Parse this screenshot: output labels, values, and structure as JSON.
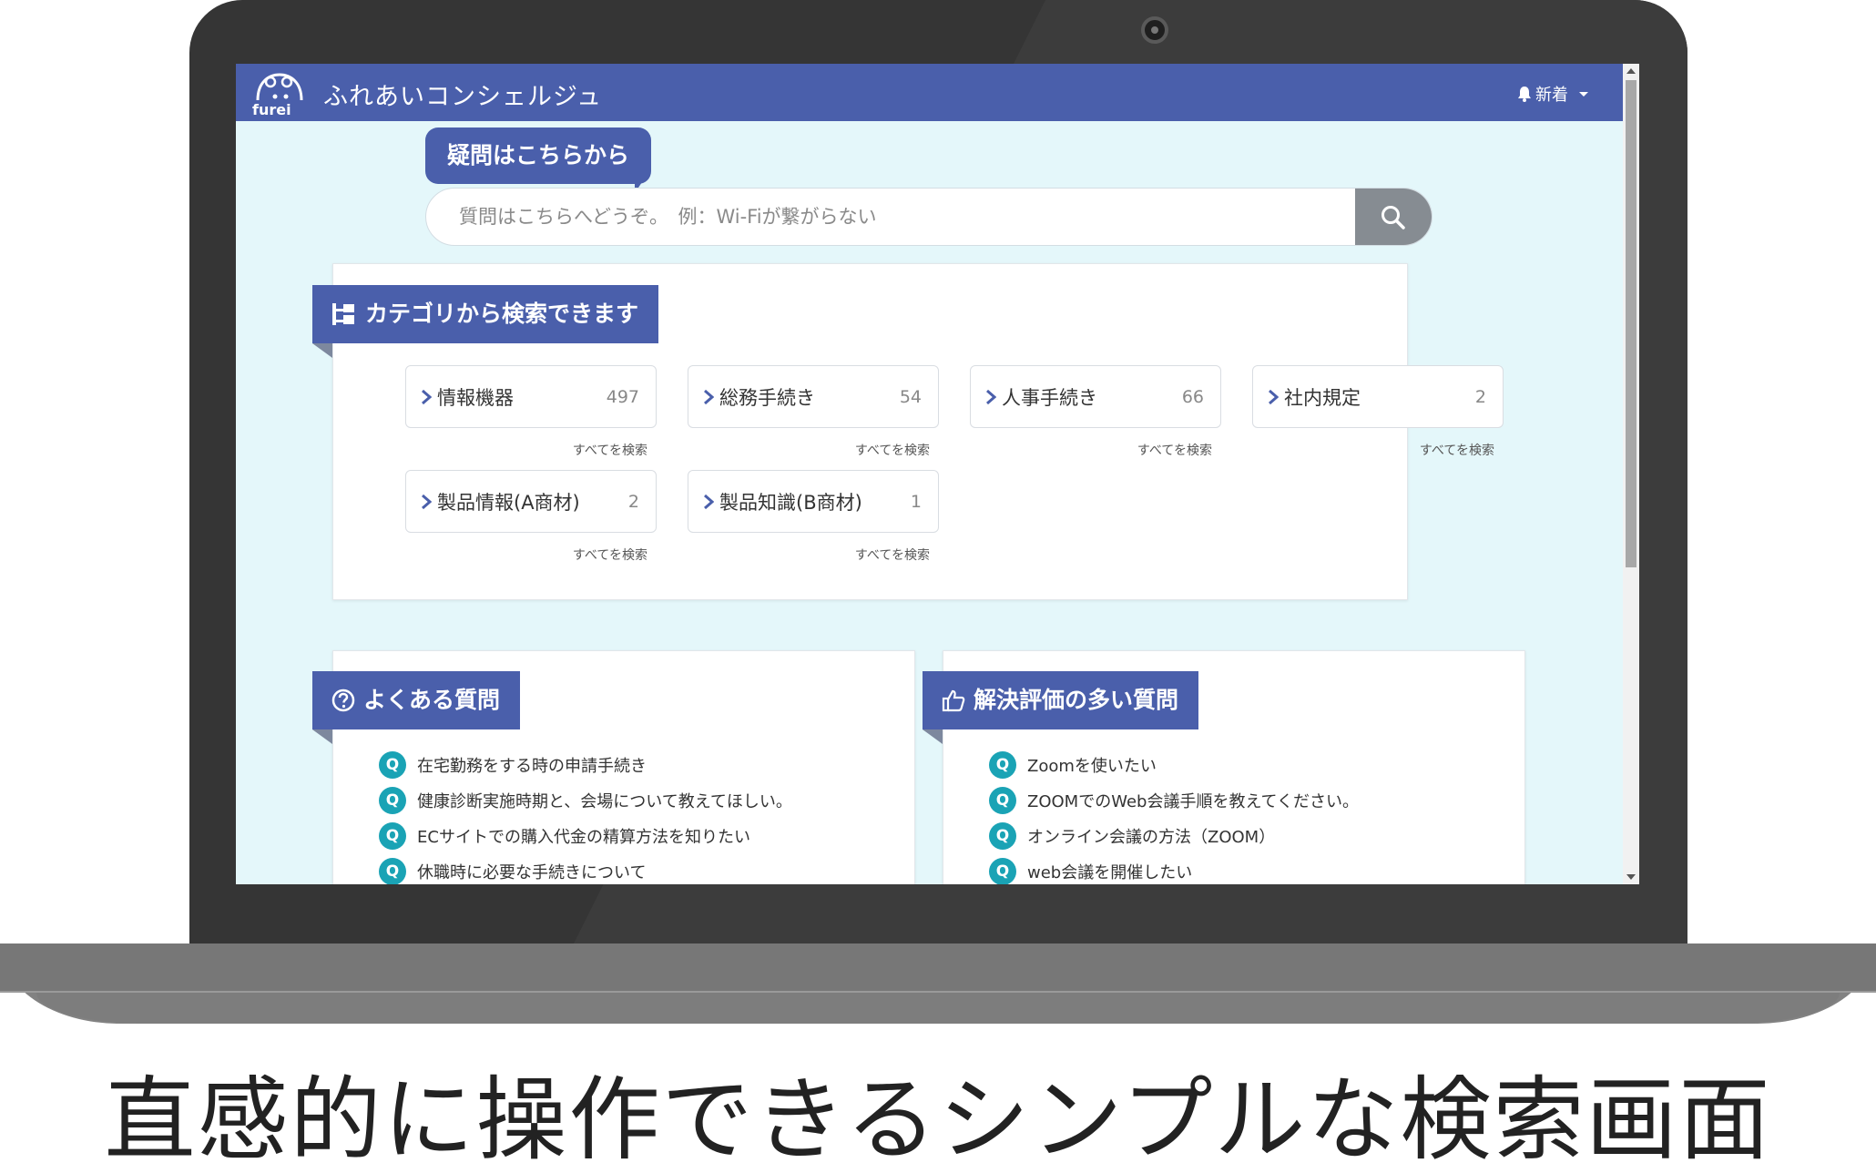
{
  "app": {
    "title": "ふれあいコンシェルジュ",
    "logo_text": "furei",
    "news_label": "新着"
  },
  "search": {
    "bubble_label": "疑問はこちらから",
    "placeholder": "質問はこちらへどうぞ。　例：Wi-Fiが繋がらない"
  },
  "categories": {
    "heading": "カテゴリから検索できます",
    "items": [
      {
        "label": "情報機器",
        "count": "497",
        "all_label": "すべてを検索"
      },
      {
        "label": "総務手続き",
        "count": "54",
        "all_label": "すべてを検索"
      },
      {
        "label": "人事手続き",
        "count": "66",
        "all_label": "すべてを検索"
      },
      {
        "label": "社内規定",
        "count": "2",
        "all_label": "すべてを検索"
      },
      {
        "label": "製品情報(A商材)",
        "count": "2",
        "all_label": "すべてを検索"
      },
      {
        "label": "製品知識(B商材)",
        "count": "1",
        "all_label": "すべてを検索"
      }
    ]
  },
  "faq": {
    "heading": "よくある質問",
    "badge": "Q",
    "items": [
      "在宅勤務をする時の申請手続き",
      "健康診断実施時期と、会場について教えてほしい。",
      "ECサイトでの購入代金の精算方法を知りたい",
      "休職時に必要な手続きについて"
    ]
  },
  "top_rated": {
    "heading": "解決評価の多い質問",
    "badge": "Q",
    "items": [
      "Zoomを使いたい",
      "ZOOMでのWeb会議手順を教えてください。",
      "オンライン会議の方法（ZOOM）",
      "web会議を開催したい"
    ]
  },
  "caption": "直感的に操作できるシンプルな検索画面",
  "colors": {
    "brand": "#4a5fab",
    "screen_bg": "#e4f7fa",
    "q_badge": "#1aa3b5",
    "laptop_body": "#353535",
    "laptop_base": "#828282"
  }
}
